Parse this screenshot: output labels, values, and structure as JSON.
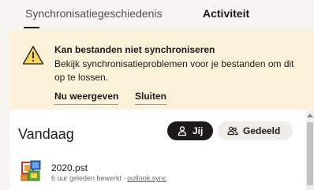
{
  "tabs": {
    "sync_history": "Synchronisatiegeschiedenis",
    "activity": "Activiteit"
  },
  "banner": {
    "icon": "warning-icon",
    "title": "Kan bestanden niet synchroniseren",
    "body": "Bekijk synchronisatieproblemen voor je bestanden om dit op te lossen.",
    "view_now": "Nu weergeven",
    "close": "Sluiten",
    "background_color": "#fcf2da",
    "icon_color": "#f7d55e"
  },
  "section": {
    "title": "Vandaag"
  },
  "filters": {
    "me": "Jij",
    "shared": "Gedeeld"
  },
  "files": [
    {
      "name": "2020.pst",
      "time": "6 uur geleden bewerkt",
      "separator": "·",
      "location": "outlook.sync",
      "icon": "outlook-pst-file-icon"
    }
  ]
}
